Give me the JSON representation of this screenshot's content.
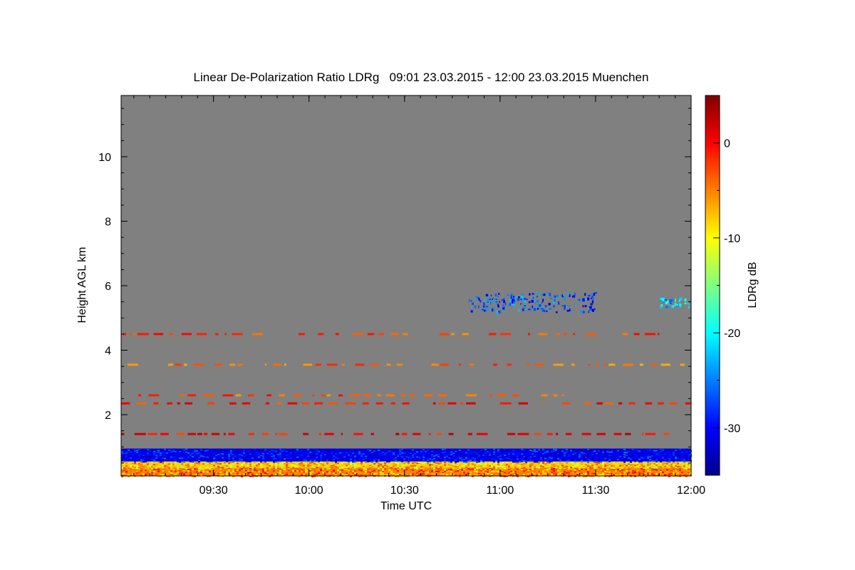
{
  "chart_data": {
    "type": "heatmap",
    "title": "Linear De-Polarization Ratio LDRg   09:01 23.03.2015 - 12:00 23.03.2015 Muenchen",
    "xlabel": "Time UTC",
    "ylabel": "Height AGL km",
    "x_ticks": [
      "09:30",
      "10:00",
      "10:30",
      "11:00",
      "11:30",
      "12:00"
    ],
    "xlim": [
      "09:01",
      "12:00"
    ],
    "y_ticks": [
      2,
      4,
      6,
      8,
      10
    ],
    "ylim": [
      0.1,
      11.9
    ],
    "background_color": "#808080",
    "colorbar": {
      "label": "LDRg dB",
      "ticks": [
        0,
        -10,
        -20,
        -30
      ],
      "range": [
        -35,
        5
      ],
      "colormap": "jet"
    },
    "features": [
      {
        "kind": "band",
        "t0": "09:01",
        "t1": "12:00",
        "h0": 0.1,
        "h1": 0.35,
        "ldr": -5,
        "mix": "orange-yellow"
      },
      {
        "kind": "band",
        "t0": "09:01",
        "t1": "12:00",
        "h0": 0.35,
        "h1": 0.55,
        "ldr": -8,
        "mix": "yellow-red"
      },
      {
        "kind": "band",
        "t0": "09:01",
        "t1": "12:00",
        "h0": 0.55,
        "h1": 0.95,
        "ldr": -31,
        "mix": "blue"
      },
      {
        "kind": "dotted_layer",
        "t0": "09:01",
        "t1": "11:50",
        "h": 4.5,
        "ldr": -3
      },
      {
        "kind": "dotted_layer",
        "t0": "09:03",
        "t1": "11:58",
        "h": 3.55,
        "ldr": -4
      },
      {
        "kind": "dotted_layer",
        "t0": "09:01",
        "t1": "12:00",
        "h": 2.35,
        "ldr": -1
      },
      {
        "kind": "dotted_layer",
        "t0": "09:04",
        "t1": "11:20",
        "h": 2.6,
        "ldr": -3
      },
      {
        "kind": "dotted_layer",
        "t0": "09:01",
        "t1": "11:53",
        "h": 1.4,
        "ldr": 0
      },
      {
        "kind": "cloud",
        "t0": "10:50",
        "t1": "11:30",
        "h0": 5.2,
        "h1": 5.8,
        "ldr": -27
      },
      {
        "kind": "cloud",
        "t0": "11:50",
        "t1": "12:00",
        "h0": 5.35,
        "h1": 5.65,
        "ldr": -22
      }
    ]
  }
}
